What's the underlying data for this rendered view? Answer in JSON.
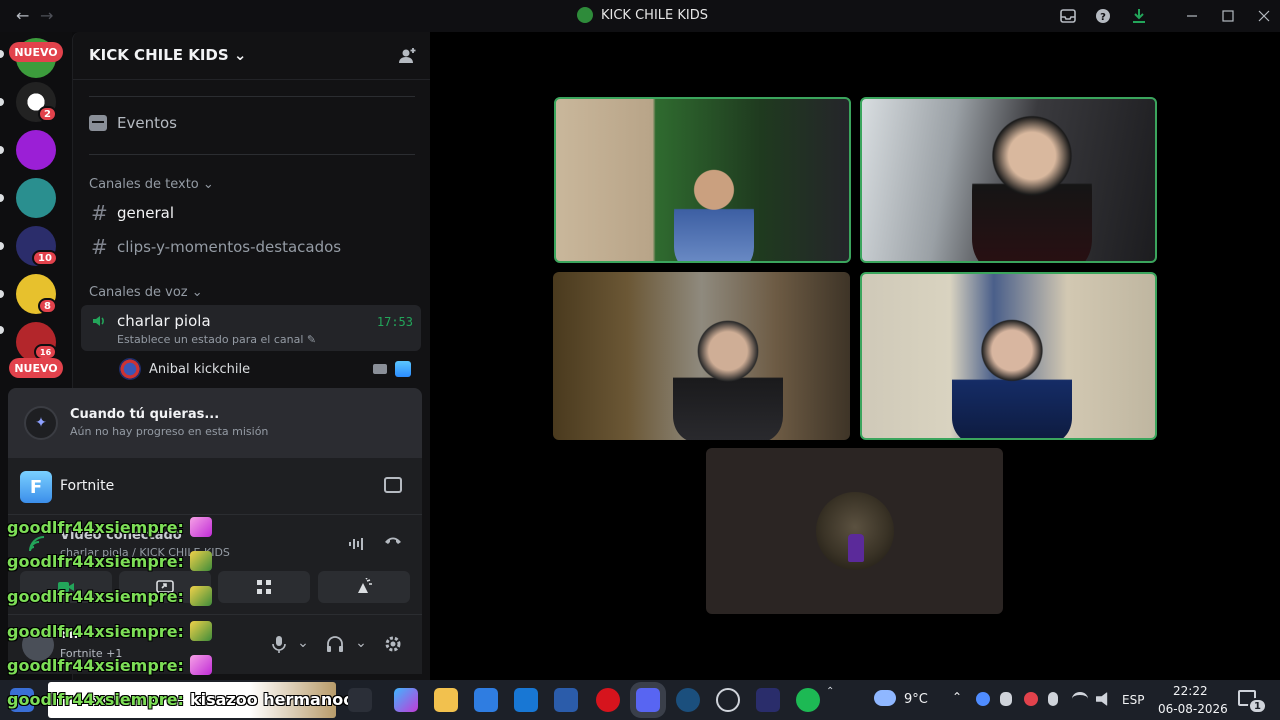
{
  "window": {
    "title": "KICK CHILE KIDS",
    "back_glyph": "←",
    "forward_glyph": "→",
    "controls": [
      "inbox-icon",
      "help-icon",
      "download-icon",
      "minimize-icon",
      "maximize-icon",
      "close-icon"
    ]
  },
  "rail": {
    "nuevo_label": "NUEVO",
    "badges": [
      "2",
      "10",
      "8",
      "16"
    ]
  },
  "server": {
    "name": "KICK CHILE KIDS",
    "chevron": "⌄"
  },
  "sidebar": {
    "events_label": "Eventos",
    "text_category": "Canales de texto",
    "voice_category": "Canales de voz",
    "text_channels": [
      "general",
      "clips-y-momentos-destacados"
    ],
    "voice_channel": {
      "name": "charlar piola",
      "time": "17:53",
      "status": "Establece un estado para el canal"
    },
    "member": {
      "name": "Anibal kickchile"
    }
  },
  "quest": {
    "title": "Cuando tú quieras...",
    "subtitle": "Aún no hay progreso en esta misión"
  },
  "game": {
    "letter": "F",
    "name": "Fortnite"
  },
  "voice_panel": {
    "status": "Vídeo conectado",
    "location": "charlar piola / KICK CHILE KIDS"
  },
  "user": {
    "name": "Eni",
    "activity": "Fortnite +1"
  },
  "chat_overlay": [
    {
      "user": "goodlfr44xsiempre:",
      "emote": "pink",
      "message": ""
    },
    {
      "user": "goodlfr44xsiempre:",
      "emote": "bird",
      "message": ""
    },
    {
      "user": "goodlfr44xsiempre:",
      "emote": "bird",
      "message": ""
    },
    {
      "user": "goodlfr44xsiempre:",
      "emote": "bird",
      "message": ""
    },
    {
      "user": "goodlfr44xsiempre:",
      "emote": "pink",
      "message": ""
    },
    {
      "user": "goodlfr44xsiempre:",
      "emote": "",
      "message": "kisazoo hermanoo"
    }
  ],
  "taskbar": {
    "weather": "9°C",
    "lang": "ESP",
    "time": "22:22",
    "date": "06-08-2026",
    "notif_count": "1"
  },
  "colors": {
    "speaking_border": "#3ba55d",
    "chat_user": "#7dde57",
    "badge": "#e2424c",
    "voice_green": "#23a55a"
  }
}
